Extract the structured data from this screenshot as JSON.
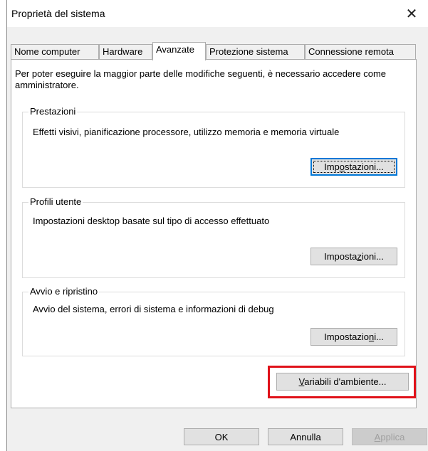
{
  "window": {
    "title": "Proprietà del sistema",
    "close_glyph": "✕"
  },
  "tabs": [
    {
      "label": "Nome computer",
      "active": false
    },
    {
      "label": "Hardware",
      "active": false
    },
    {
      "label": "Avanzate",
      "active": true
    },
    {
      "label": "Protezione sistema",
      "active": false
    },
    {
      "label": "Connessione remota",
      "active": false
    }
  ],
  "intro_text": "Per poter eseguire la maggior parte delle modifiche seguenti, è necessario accedere come amministratore.",
  "groups": {
    "performance": {
      "title": "Prestazioni",
      "description": "Effetti visivi, pianificazione processore, utilizzo memoria e memoria virtuale",
      "button": {
        "pre": "Imp",
        "key": "o",
        "post": "stazioni..."
      }
    },
    "user_profiles": {
      "title": "Profili utente",
      "description": "Impostazioni desktop basate sul tipo di accesso effettuato",
      "button": {
        "pre": "Imposta",
        "key": "z",
        "post": "ioni..."
      }
    },
    "startup": {
      "title": "Avvio e ripristino",
      "description": "Avvio del sistema, errori di sistema e informazioni di debug",
      "button": {
        "pre": "Impostazio",
        "key": "n",
        "post": "i..."
      }
    }
  },
  "env_button": {
    "pre": "",
    "key": "V",
    "post": "ariabili d'ambiente..."
  },
  "footer": {
    "ok": "OK",
    "cancel": "Annulla",
    "apply": {
      "pre": "",
      "key": "A",
      "post": "pplica"
    }
  },
  "colors": {
    "highlight_border": "#e0121a",
    "default_button_border": "#0078d7"
  }
}
